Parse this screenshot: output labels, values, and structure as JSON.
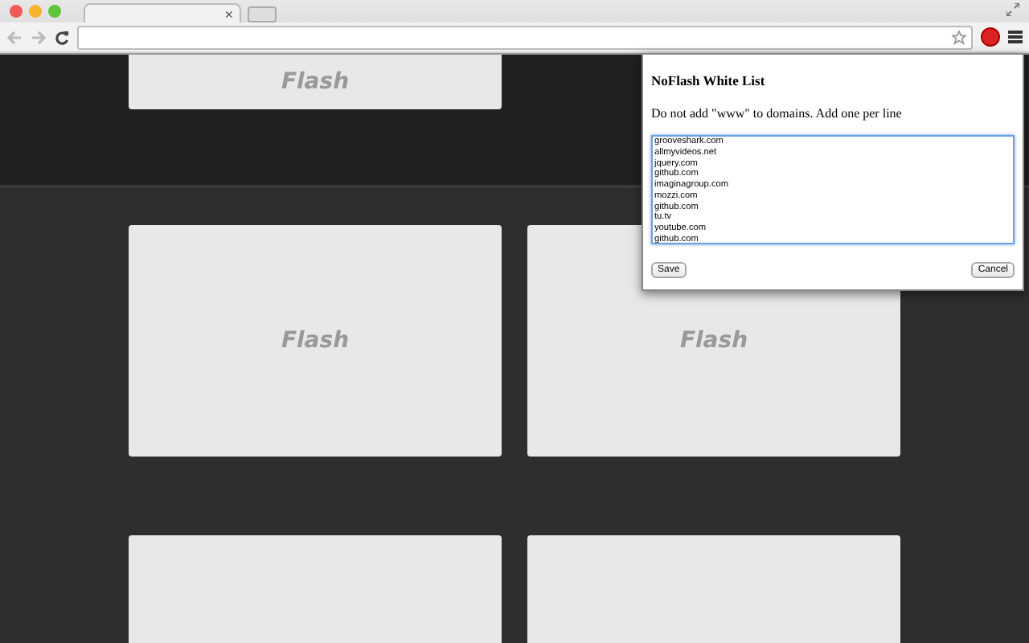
{
  "browser": {
    "tab_close": "×"
  },
  "page": {
    "top_tiles": [
      {
        "kind": "labeled",
        "label": "Flash"
      }
    ],
    "tiles": [
      {
        "kind": "labeled",
        "label": "Flash"
      },
      {
        "kind": "labeled",
        "label": "Flash"
      },
      {
        "kind": "blank"
      },
      {
        "kind": "blank"
      }
    ]
  },
  "popup": {
    "title": "NoFlash White List",
    "hint": "Do not add \"www\" to domains. Add one per line",
    "domains": [
      "grooveshark.com",
      "allmyvideos.net",
      "jquery.com",
      "github.com",
      "imaginagroup.com",
      "mozzi.com",
      "github.com",
      "tu.tv",
      "youtube.com",
      "github.com"
    ],
    "buttons": [
      {
        "label": "Save",
        "kind": "save"
      },
      {
        "label": "Cancel",
        "kind": "cancel"
      }
    ]
  }
}
